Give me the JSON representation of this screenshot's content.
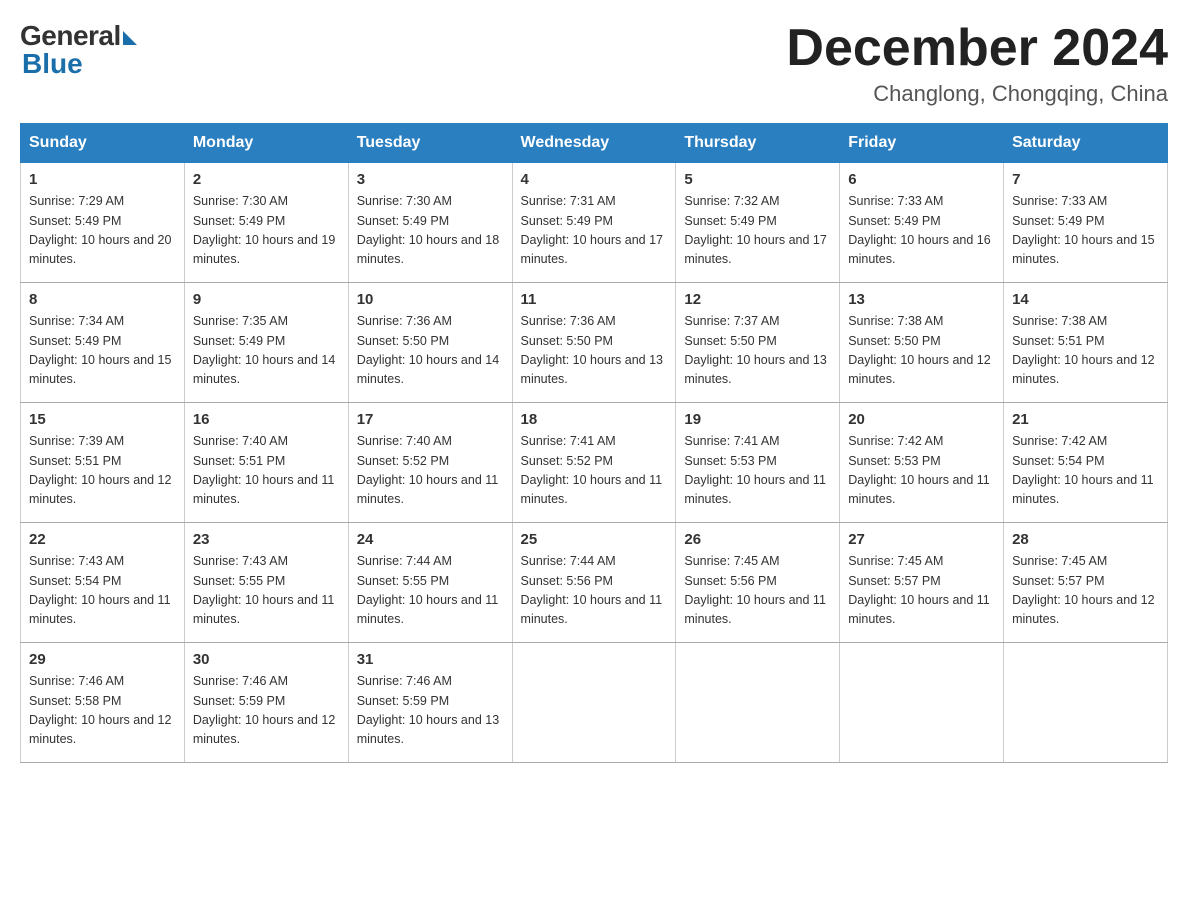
{
  "logo": {
    "general": "General",
    "blue": "Blue"
  },
  "title": "December 2024",
  "location": "Changlong, Chongqing, China",
  "days_of_week": [
    "Sunday",
    "Monday",
    "Tuesday",
    "Wednesday",
    "Thursday",
    "Friday",
    "Saturday"
  ],
  "weeks": [
    [
      {
        "day": "1",
        "sunrise": "7:29 AM",
        "sunset": "5:49 PM",
        "daylight": "10 hours and 20 minutes."
      },
      {
        "day": "2",
        "sunrise": "7:30 AM",
        "sunset": "5:49 PM",
        "daylight": "10 hours and 19 minutes."
      },
      {
        "day": "3",
        "sunrise": "7:30 AM",
        "sunset": "5:49 PM",
        "daylight": "10 hours and 18 minutes."
      },
      {
        "day": "4",
        "sunrise": "7:31 AM",
        "sunset": "5:49 PM",
        "daylight": "10 hours and 17 minutes."
      },
      {
        "day": "5",
        "sunrise": "7:32 AM",
        "sunset": "5:49 PM",
        "daylight": "10 hours and 17 minutes."
      },
      {
        "day": "6",
        "sunrise": "7:33 AM",
        "sunset": "5:49 PM",
        "daylight": "10 hours and 16 minutes."
      },
      {
        "day": "7",
        "sunrise": "7:33 AM",
        "sunset": "5:49 PM",
        "daylight": "10 hours and 15 minutes."
      }
    ],
    [
      {
        "day": "8",
        "sunrise": "7:34 AM",
        "sunset": "5:49 PM",
        "daylight": "10 hours and 15 minutes."
      },
      {
        "day": "9",
        "sunrise": "7:35 AM",
        "sunset": "5:49 PM",
        "daylight": "10 hours and 14 minutes."
      },
      {
        "day": "10",
        "sunrise": "7:36 AM",
        "sunset": "5:50 PM",
        "daylight": "10 hours and 14 minutes."
      },
      {
        "day": "11",
        "sunrise": "7:36 AM",
        "sunset": "5:50 PM",
        "daylight": "10 hours and 13 minutes."
      },
      {
        "day": "12",
        "sunrise": "7:37 AM",
        "sunset": "5:50 PM",
        "daylight": "10 hours and 13 minutes."
      },
      {
        "day": "13",
        "sunrise": "7:38 AM",
        "sunset": "5:50 PM",
        "daylight": "10 hours and 12 minutes."
      },
      {
        "day": "14",
        "sunrise": "7:38 AM",
        "sunset": "5:51 PM",
        "daylight": "10 hours and 12 minutes."
      }
    ],
    [
      {
        "day": "15",
        "sunrise": "7:39 AM",
        "sunset": "5:51 PM",
        "daylight": "10 hours and 12 minutes."
      },
      {
        "day": "16",
        "sunrise": "7:40 AM",
        "sunset": "5:51 PM",
        "daylight": "10 hours and 11 minutes."
      },
      {
        "day": "17",
        "sunrise": "7:40 AM",
        "sunset": "5:52 PM",
        "daylight": "10 hours and 11 minutes."
      },
      {
        "day": "18",
        "sunrise": "7:41 AM",
        "sunset": "5:52 PM",
        "daylight": "10 hours and 11 minutes."
      },
      {
        "day": "19",
        "sunrise": "7:41 AM",
        "sunset": "5:53 PM",
        "daylight": "10 hours and 11 minutes."
      },
      {
        "day": "20",
        "sunrise": "7:42 AM",
        "sunset": "5:53 PM",
        "daylight": "10 hours and 11 minutes."
      },
      {
        "day": "21",
        "sunrise": "7:42 AM",
        "sunset": "5:54 PM",
        "daylight": "10 hours and 11 minutes."
      }
    ],
    [
      {
        "day": "22",
        "sunrise": "7:43 AM",
        "sunset": "5:54 PM",
        "daylight": "10 hours and 11 minutes."
      },
      {
        "day": "23",
        "sunrise": "7:43 AM",
        "sunset": "5:55 PM",
        "daylight": "10 hours and 11 minutes."
      },
      {
        "day": "24",
        "sunrise": "7:44 AM",
        "sunset": "5:55 PM",
        "daylight": "10 hours and 11 minutes."
      },
      {
        "day": "25",
        "sunrise": "7:44 AM",
        "sunset": "5:56 PM",
        "daylight": "10 hours and 11 minutes."
      },
      {
        "day": "26",
        "sunrise": "7:45 AM",
        "sunset": "5:56 PM",
        "daylight": "10 hours and 11 minutes."
      },
      {
        "day": "27",
        "sunrise": "7:45 AM",
        "sunset": "5:57 PM",
        "daylight": "10 hours and 11 minutes."
      },
      {
        "day": "28",
        "sunrise": "7:45 AM",
        "sunset": "5:57 PM",
        "daylight": "10 hours and 12 minutes."
      }
    ],
    [
      {
        "day": "29",
        "sunrise": "7:46 AM",
        "sunset": "5:58 PM",
        "daylight": "10 hours and 12 minutes."
      },
      {
        "day": "30",
        "sunrise": "7:46 AM",
        "sunset": "5:59 PM",
        "daylight": "10 hours and 12 minutes."
      },
      {
        "day": "31",
        "sunrise": "7:46 AM",
        "sunset": "5:59 PM",
        "daylight": "10 hours and 13 minutes."
      },
      null,
      null,
      null,
      null
    ]
  ]
}
